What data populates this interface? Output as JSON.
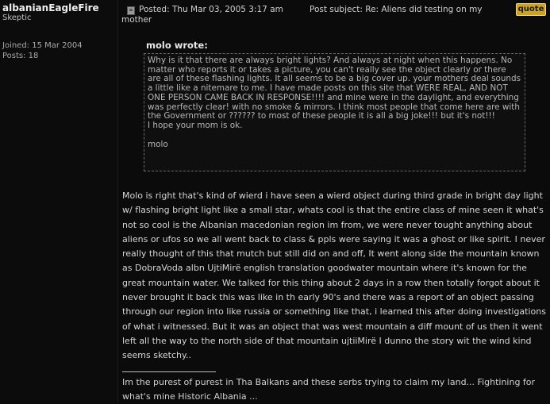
{
  "author": {
    "username": "albanianEagleFire",
    "rank": "Skeptic",
    "joined": "Joined: 15 Mar 2004",
    "posts": "Posts: 18"
  },
  "post": {
    "posted": "Posted: Thu Mar 03, 2005 3:17 am",
    "subject_label": "Post subject: Re: Aliens did testing on my",
    "subject_cont": "mother",
    "quote_button": "quote",
    "quote_author": "molo wrote:",
    "quote_text": "Why is it that there are always bright lights? And always at night when this happens. No matter who reports it or takes a picture, you can't really see the object clearly or there are all of these flashing lights. It all seems to be a big cover up. your mothers deal sounds a little like a nitemare to me. I have made posts on this site that WERE REAL, AND NOT ONE PERSON CAME BACK IN RESPONSE!!!! and mine were in the daylight, and everything was perfectly clear! with no smoke & mirrors. I think most people that come here are with the Government or ?????? to most of these people it is all a big joke!!! but it's not!!!\nI hope your mom is ok.",
    "quote_signature": "molo",
    "body": "Molo is right that's kind of wierd i have seen a wierd object during third grade in bright day light w/ flashing bright light like a small star, whats cool is that the entire class of mine seen it what's not so cool is the Albanian macedonian region im from, we were never tought anything about aliens or ufos so we all went back to class & ppls were saying it was a ghost or like spirit. I never really thought of this that mutch but still did on and off, It went along side the mountain known as DobraVoda albn UjtiMirë english translation goodwater mountain where it's known for the great mountain water. We talked for this thing about 2 days in a row then totally forgot about it never brought it back this was like in th early 90's and there was a report of an object passing through our region into like russia or something like that, i learned this after doing investigations of what i witnessed. But it was an object that was west mountain a diff mount of us then it went left all the way to the north side of that mountain ujtiiMirë I dunno the story wit the wind kind seems sketchy..",
    "signature": "Im the purest of purest in Tha Balkans and these serbs trying to claim my land... Fightining for what's mine Historic Albania ..."
  },
  "colors": {
    "background": "#0b0b0b",
    "quote_button": "#caa32c",
    "text": "#d6d6d6"
  }
}
